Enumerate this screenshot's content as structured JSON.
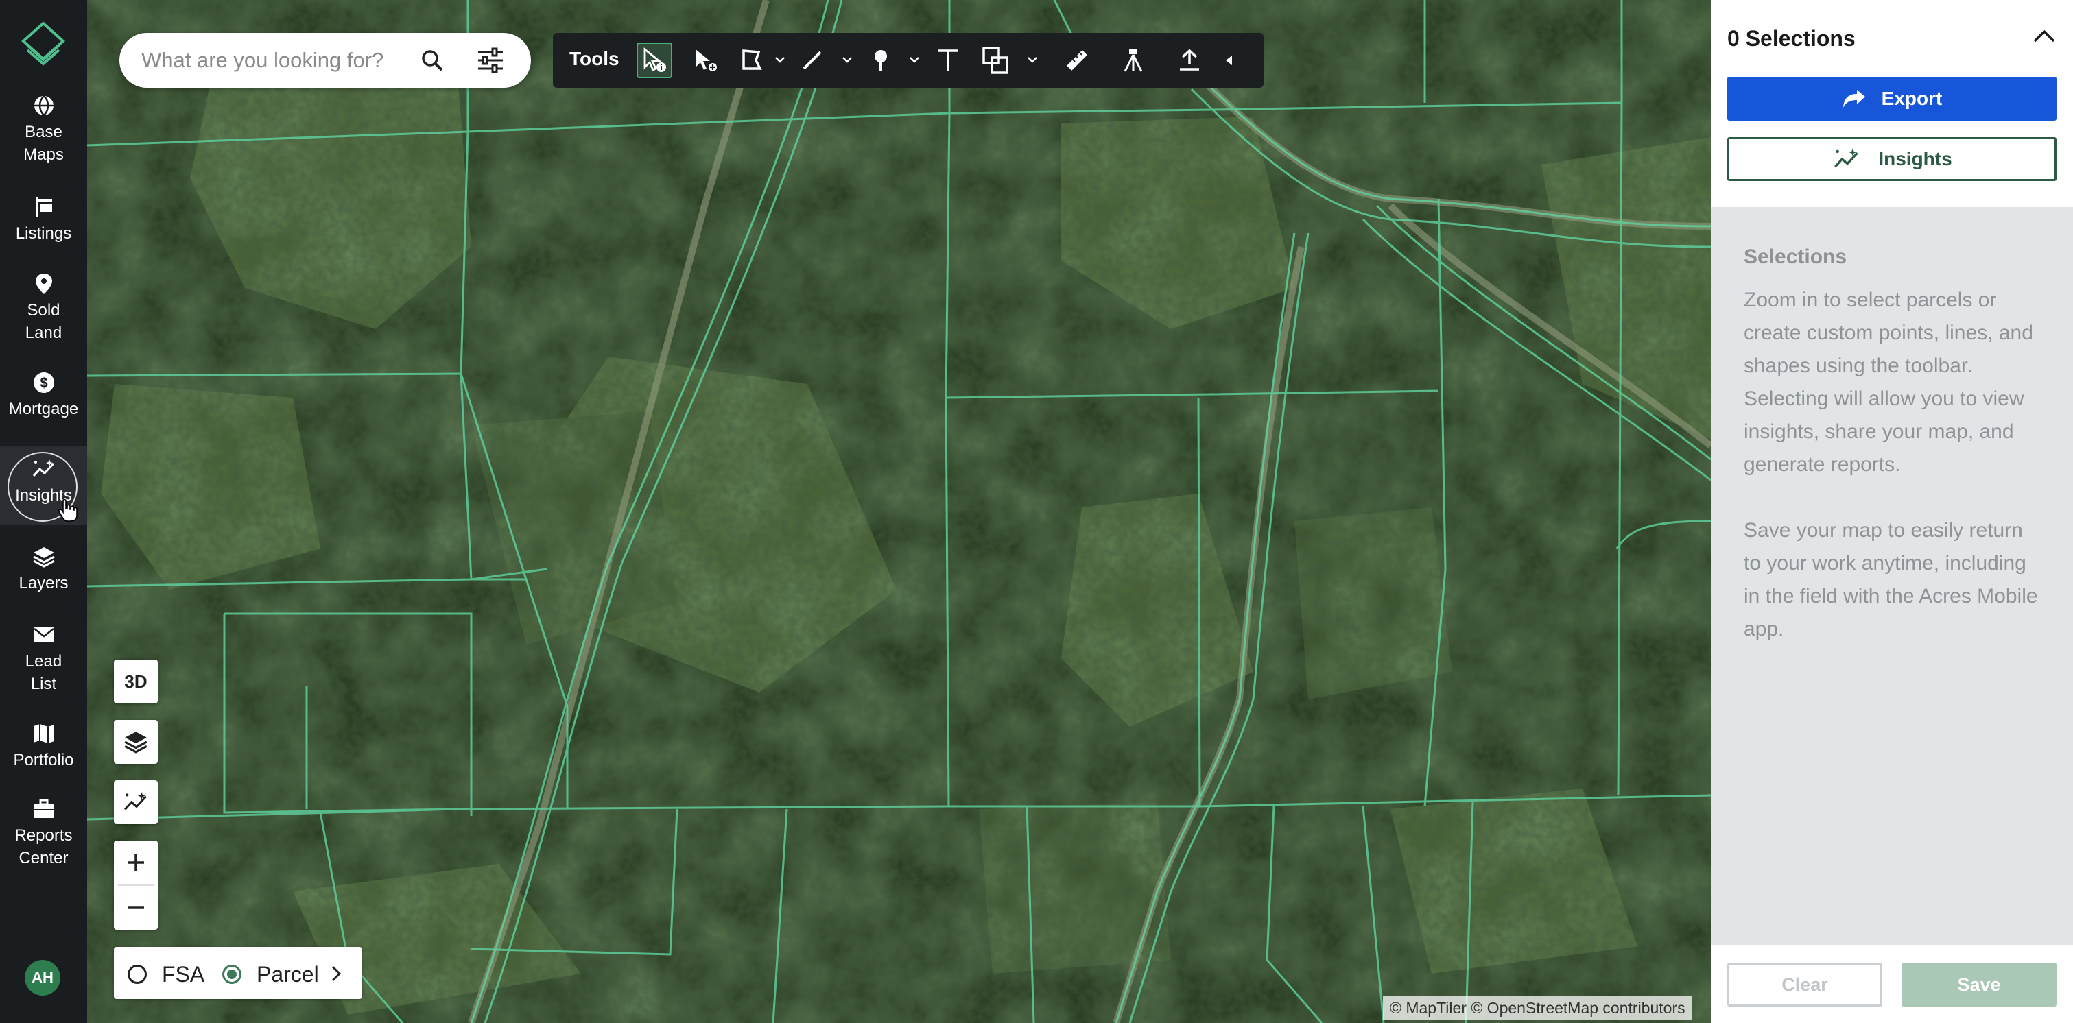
{
  "sidebar": {
    "items": [
      {
        "label": "Base\nMaps",
        "icon": "globe-icon"
      },
      {
        "label": "Listings",
        "icon": "listing-sign-icon"
      },
      {
        "label": "Sold\nLand",
        "icon": "map-pin-icon"
      },
      {
        "label": "Mortgage",
        "icon": "dollar-coin-icon"
      },
      {
        "label": "Insights",
        "icon": "insights-sparkle-icon"
      },
      {
        "label": "Layers",
        "icon": "layers-icon"
      },
      {
        "label": "Lead\nList",
        "icon": "envelope-icon"
      },
      {
        "label": "Portfolio",
        "icon": "folded-map-icon"
      },
      {
        "label": "Reports\nCenter",
        "icon": "briefcase-icon"
      }
    ],
    "active_item": "Insights",
    "avatar_initials": "AH"
  },
  "search": {
    "placeholder": "What are you looking for?"
  },
  "toolbar": {
    "label": "Tools",
    "active_tool": "select-info"
  },
  "map_controls": {
    "three_d_label": "3D",
    "zoom_in": "+",
    "zoom_out": "−",
    "layer_options": [
      {
        "label": "FSA",
        "selected": false
      },
      {
        "label": "Parcel",
        "selected": true
      }
    ]
  },
  "attribution": "© MapTiler © OpenStreetMap contributors",
  "panel": {
    "title": "0 Selections",
    "export_label": "Export",
    "insights_label": "Insights",
    "section_title": "Selections",
    "body_paragraph_1": "Zoom in to select parcels or create custom points, lines, and shapes using the toolbar. Selecting will allow you to view insights, share your map, and generate reports.",
    "body_paragraph_2": "Save your map to easily return to your work anytime, including in the field with the Acres Mobile app.",
    "clear_label": "Clear",
    "save_label": "Save"
  },
  "colors": {
    "sidebar_bg": "#1a1d20",
    "export_blue": "#1756d8",
    "insights_green": "#2d5a45",
    "parcel_line": "#5fd3a0",
    "save_disabled": "#a9c8b5"
  }
}
